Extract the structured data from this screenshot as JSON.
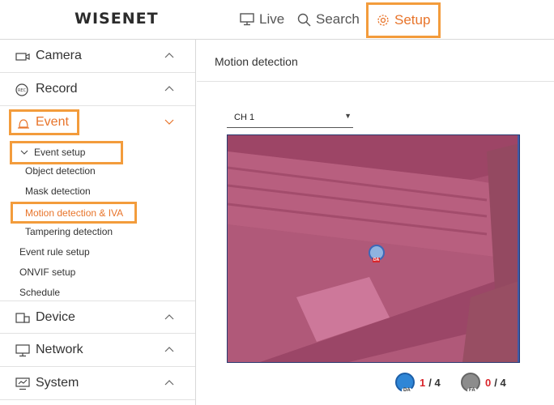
{
  "header": {
    "logo": "WISENET",
    "nav": {
      "live": "Live",
      "search": "Search",
      "setup": "Setup"
    }
  },
  "sidebar": {
    "items": [
      {
        "label": "Camera",
        "icon": "camera-icon"
      },
      {
        "label": "Record",
        "icon": "record-icon"
      },
      {
        "label": "Event",
        "icon": "bell-icon"
      },
      {
        "label": "Device",
        "icon": "device-icon"
      },
      {
        "label": "Network",
        "icon": "monitor-icon"
      },
      {
        "label": "System",
        "icon": "system-icon"
      }
    ],
    "event_sub": {
      "setup_label": "Event setup",
      "setup_items": [
        "Object detection",
        "Mask detection",
        "Motion detection & IVA",
        "Tampering detection"
      ],
      "other_items": [
        "Event rule setup",
        "ONVIF setup",
        "Schedule"
      ]
    }
  },
  "content": {
    "title": "Motion detection",
    "channel": "CH 1",
    "da_current": "1",
    "da_total": "/ 4",
    "fa_current": "0",
    "fa_total": "/ 4",
    "da_badge": "DA",
    "fa_badge": "FA",
    "marker_label": "DA"
  },
  "colors": {
    "accent": "#e8742a",
    "highlight_border": "#f39c3c",
    "overlay": "#cf3c78",
    "count_active": "#d9252b"
  }
}
